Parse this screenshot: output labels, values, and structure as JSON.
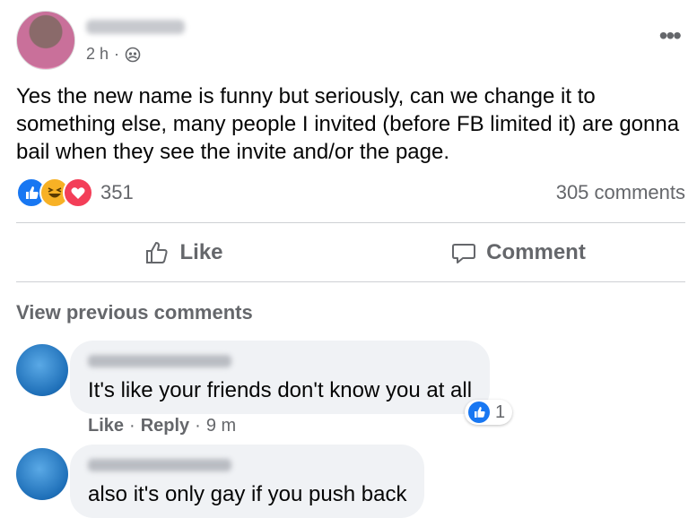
{
  "post": {
    "time": "2 h",
    "separator": "·",
    "privacy_icon": "friends-icon",
    "more_icon": "more-options-icon",
    "text": "Yes the new name is funny but seriously, can we change it to something else, many people I invited (before FB limited it) are gonna bail when they see the invite and/or the page.",
    "reactions": {
      "icons": [
        "like-reaction-icon",
        "haha-reaction-icon",
        "love-reaction-icon"
      ],
      "count": "351"
    },
    "comments_count": "305 comments",
    "actions": {
      "like_label": "Like",
      "comment_label": "Comment"
    }
  },
  "view_previous_label": "View previous comments",
  "comments": [
    {
      "text": "It's like your friends don't know you at all",
      "like_label": "Like",
      "reply_label": "Reply",
      "time": "9 m",
      "reaction_count": "1"
    },
    {
      "text": "also it's only gay if you push back"
    }
  ],
  "colors": {
    "accent": "#1877f2",
    "secondary_text": "#65676b",
    "bubble": "#f0f2f5",
    "divider": "#ced0d4"
  }
}
